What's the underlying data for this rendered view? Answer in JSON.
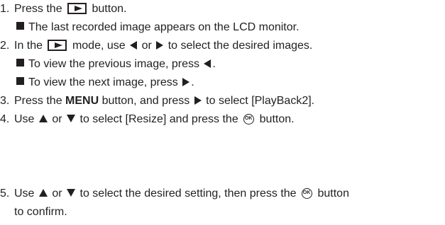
{
  "steps": [
    {
      "num": "1.",
      "t1": "Press the",
      "t2": "button."
    },
    {
      "t": "The last recorded image appears on the LCD monitor."
    },
    {
      "num": "2.",
      "t1": "In the",
      "t2": "mode, use",
      "t3": "or",
      "t4": "to select the desired images."
    },
    {
      "t": "To view the previous image, press",
      "end": "."
    },
    {
      "t": "To view the next image, press",
      "end": "."
    },
    {
      "num": "3.",
      "t1": "Press the",
      "bold": "MENU",
      "t2": "button, and press",
      "t3": "to select [PlayBack2]."
    },
    {
      "num": "4.",
      "t1": "Use",
      "t2": "or",
      "t3": "to select [Resize] and press the",
      "t4": "button."
    },
    {
      "num": "5.",
      "t1": "Use",
      "t2": "or",
      "t3": "to select the desired setting, then press the",
      "t4": "button"
    },
    {
      "t": "to confirm."
    }
  ],
  "icons": [
    "play-button-icon",
    "ok-button-icon",
    "left-arrow-icon",
    "right-arrow-icon",
    "up-arrow-icon",
    "down-arrow-icon",
    "bullet-square-icon"
  ]
}
